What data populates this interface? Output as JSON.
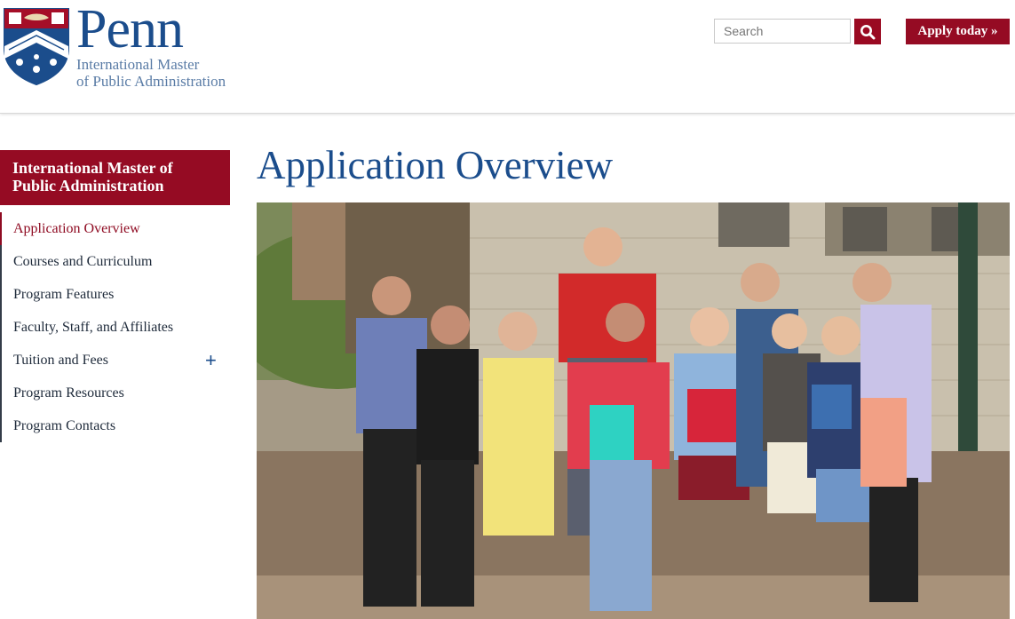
{
  "header": {
    "logo_word": "Penn",
    "logo_sub_line1": "International Master",
    "logo_sub_line2": "of Public Administration",
    "search_placeholder": "Search",
    "apply_label": "Apply today »"
  },
  "sidebar": {
    "title_line1": "International Master of",
    "title_line2": "Public Administration",
    "items": [
      {
        "label": "Application Overview",
        "active": true
      },
      {
        "label": "Courses and Curriculum"
      },
      {
        "label": "Program Features"
      },
      {
        "label": "Faculty, Staff, and Affiliates"
      },
      {
        "label": "Tuition and Fees",
        "expandable": true,
        "expand_symbol": "+"
      },
      {
        "label": "Program Resources"
      },
      {
        "label": "Program Contacts"
      }
    ]
  },
  "main": {
    "title": "Application Overview"
  },
  "colors": {
    "penn_blue": "#1b4d8c",
    "penn_red": "#950b23",
    "nav_text": "#1e2a3a"
  },
  "icons": {
    "logo": "penn-shield-icon",
    "search": "search-icon",
    "expand": "plus-icon"
  }
}
